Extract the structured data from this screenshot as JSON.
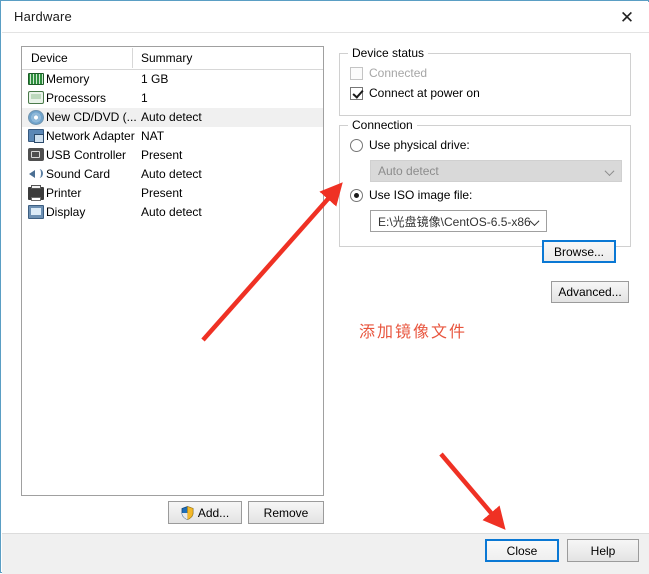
{
  "window": {
    "title": "Hardware",
    "close_icon": "close-icon"
  },
  "device_list": {
    "columns": [
      "Device",
      "Summary"
    ],
    "rows": [
      {
        "icon": "memory-icon",
        "label": "Memory",
        "summary": "1 GB",
        "selected": false
      },
      {
        "icon": "processor-icon",
        "label": "Processors",
        "summary": "1",
        "selected": false
      },
      {
        "icon": "cd-dvd-icon",
        "label": "New CD/DVD (...",
        "summary": "Auto detect",
        "selected": true
      },
      {
        "icon": "network-icon",
        "label": "Network Adapter",
        "summary": "NAT",
        "selected": false
      },
      {
        "icon": "usb-icon",
        "label": "USB Controller",
        "summary": "Present",
        "selected": false
      },
      {
        "icon": "sound-icon",
        "label": "Sound Card",
        "summary": "Auto detect",
        "selected": false
      },
      {
        "icon": "printer-icon",
        "label": "Printer",
        "summary": "Present",
        "selected": false
      },
      {
        "icon": "display-icon",
        "label": "Display",
        "summary": "Auto detect",
        "selected": false
      }
    ],
    "add_label": "Add...",
    "remove_label": "Remove"
  },
  "device_status": {
    "title": "Device status",
    "connected_label": "Connected",
    "connected_checked": false,
    "connect_power_label": "Connect at power on",
    "connect_power_checked": true
  },
  "connection": {
    "title": "Connection",
    "physical_label": "Use physical drive:",
    "physical_selected": false,
    "physical_value": "Auto detect",
    "iso_label": "Use ISO image file:",
    "iso_selected": true,
    "iso_value": "E:\\光盘镜像\\CentOS-6.5-x86",
    "browse_label": "Browse...",
    "advanced_label": "Advanced..."
  },
  "annotation": {
    "text": "添加镜像文件",
    "color": "#e8553e"
  },
  "footer": {
    "close_label": "Close",
    "help_label": "Help"
  }
}
